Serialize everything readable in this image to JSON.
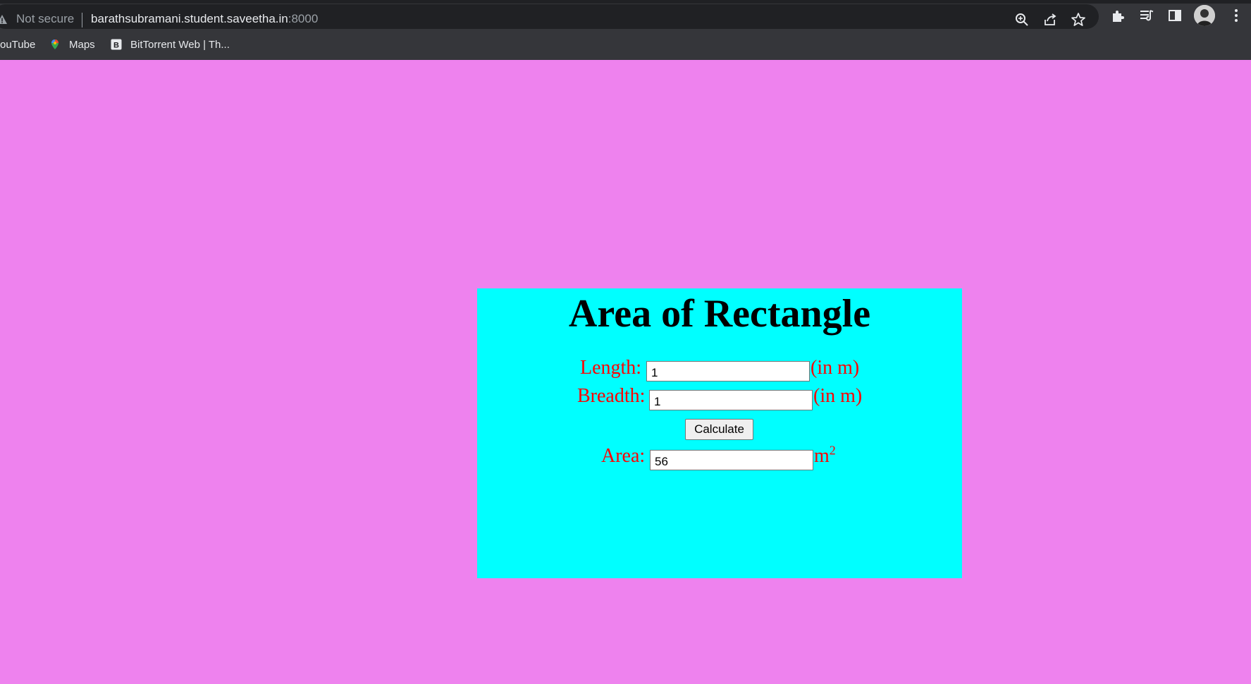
{
  "browser": {
    "security_label": "Not secure",
    "url_host": "barathsubramani.student.saveetha.in",
    "url_port": ":8000",
    "bookmarks": [
      {
        "label": "ouTube",
        "icon": "youtube-icon"
      },
      {
        "label": "Maps",
        "icon": "maps-pin-icon"
      },
      {
        "label": "BitTorrent Web | Th...",
        "icon": "bittorrent-icon"
      }
    ],
    "toolbar_icons": [
      "zoom-icon",
      "share-icon",
      "star-icon",
      "extensions-icon",
      "media-icon",
      "side-panel-icon",
      "profile-avatar",
      "menu-kebab-icon"
    ]
  },
  "colors": {
    "page_background": "#ee82ee",
    "card_background": "#00ffff",
    "label_color": "#ff0000",
    "title_color": "#000000"
  },
  "form": {
    "title": "Area of Rectangle",
    "length_label": "Length:",
    "length_value": "1",
    "length_unit": "(in m)",
    "breadth_label": "Breadth:",
    "breadth_value": "1",
    "breadth_unit": "(in m)",
    "calculate_label": "Calculate",
    "area_label": "Area:",
    "area_value": "56",
    "area_unit_base": "m",
    "area_unit_exp": "2"
  }
}
